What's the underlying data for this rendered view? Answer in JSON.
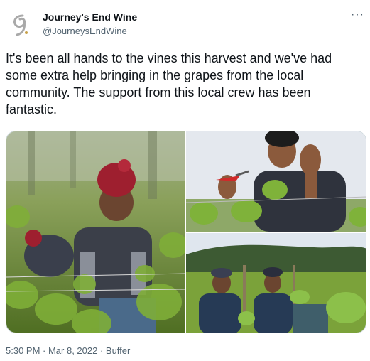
{
  "account": {
    "display_name": "Journey's End Wine",
    "handle": "@JourneysEndWine",
    "avatar_icon": "journeys-end-logo-icon"
  },
  "more_icon": "more-dots-icon",
  "more_label": "···",
  "tweet": {
    "text": "It's been all hands to the vines this harvest and we've had some extra help bringing in the grapes from the local community. The support from this local crew has been fantastic."
  },
  "media": {
    "photos": [
      {
        "subject": "vineyard-worker-red-beanie"
      },
      {
        "subject": "worker-waving-with-shears"
      },
      {
        "subject": "two-workers-in-vineyard"
      }
    ]
  },
  "meta": {
    "timestamp": "5:30 PM · Mar 8, 2022 · Buffer"
  },
  "colors": {
    "text": "#0f1419",
    "secondary": "#536471",
    "border": "#cfd9de",
    "vine_green": "#6b9a2e",
    "beanie_red": "#9e1f2f"
  }
}
